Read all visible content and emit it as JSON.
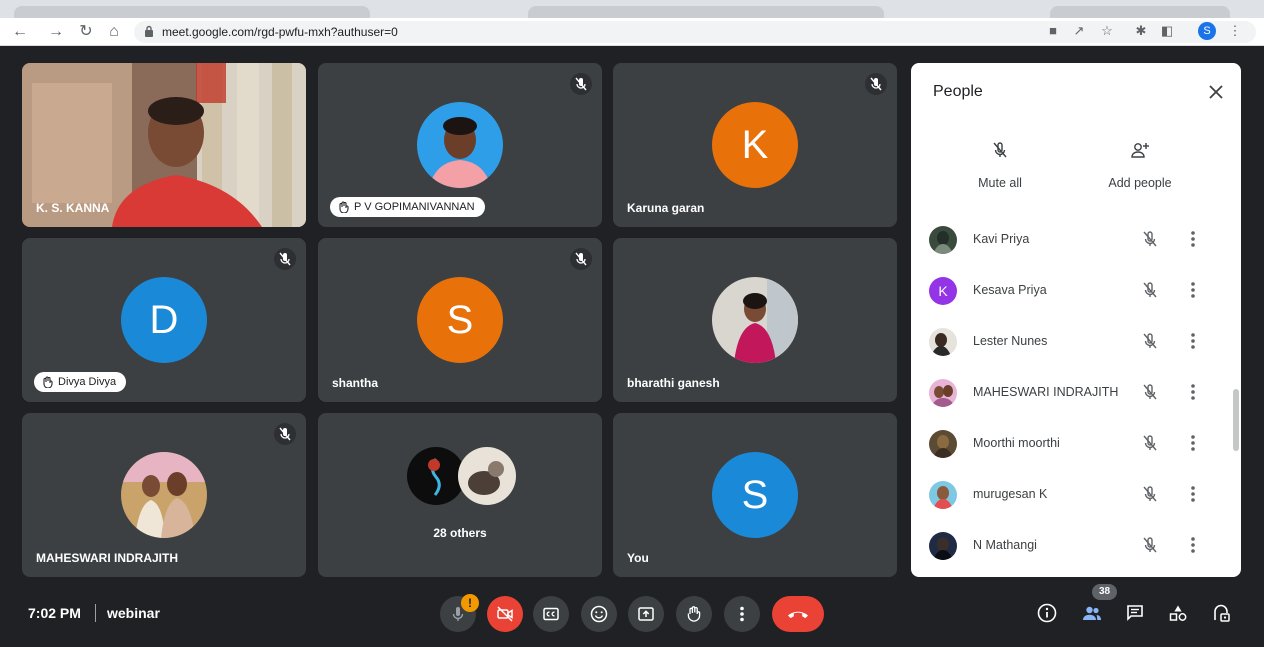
{
  "browser": {
    "url": "meet.google.com/rgd-pwfu-mxh?authuser=0",
    "profile_initial": "S"
  },
  "tiles": [
    {
      "name": "K. S. KANNA"
    },
    {
      "name": "P V GOPIMANIVANNAN"
    },
    {
      "name": "Karuna garan",
      "initial": "K"
    },
    {
      "name": "Divya Divya",
      "initial": "D"
    },
    {
      "name": "shantha",
      "initial": "S"
    },
    {
      "name": "bharathi ganesh"
    },
    {
      "name": "MAHESWARI INDRAJITH"
    },
    {
      "name": "28 others"
    },
    {
      "name": "You",
      "initial": "S"
    }
  ],
  "people_panel": {
    "title": "People",
    "mute_all": "Mute all",
    "add_people": "Add people",
    "people": [
      {
        "name": "Kavi Priya"
      },
      {
        "name": "Kesava Priya",
        "initial": "K"
      },
      {
        "name": "Lester Nunes"
      },
      {
        "name": "MAHESWARI INDRAJITH"
      },
      {
        "name": "Moorthi moorthi"
      },
      {
        "name": "murugesan K"
      },
      {
        "name": "N Mathangi"
      }
    ]
  },
  "bottom_bar": {
    "time": "7:02 PM",
    "meeting_name": "webinar",
    "warning_badge": "!",
    "participants_count": "38"
  },
  "colors": {
    "background": "#202124",
    "tile": "#3c4043",
    "orange_avatar": "#e8710a",
    "blue_avatar": "#1a8ad8",
    "purple_avatar": "#9334e6",
    "red_control": "#ea4335",
    "accent_blue": "#8ab4f8"
  }
}
